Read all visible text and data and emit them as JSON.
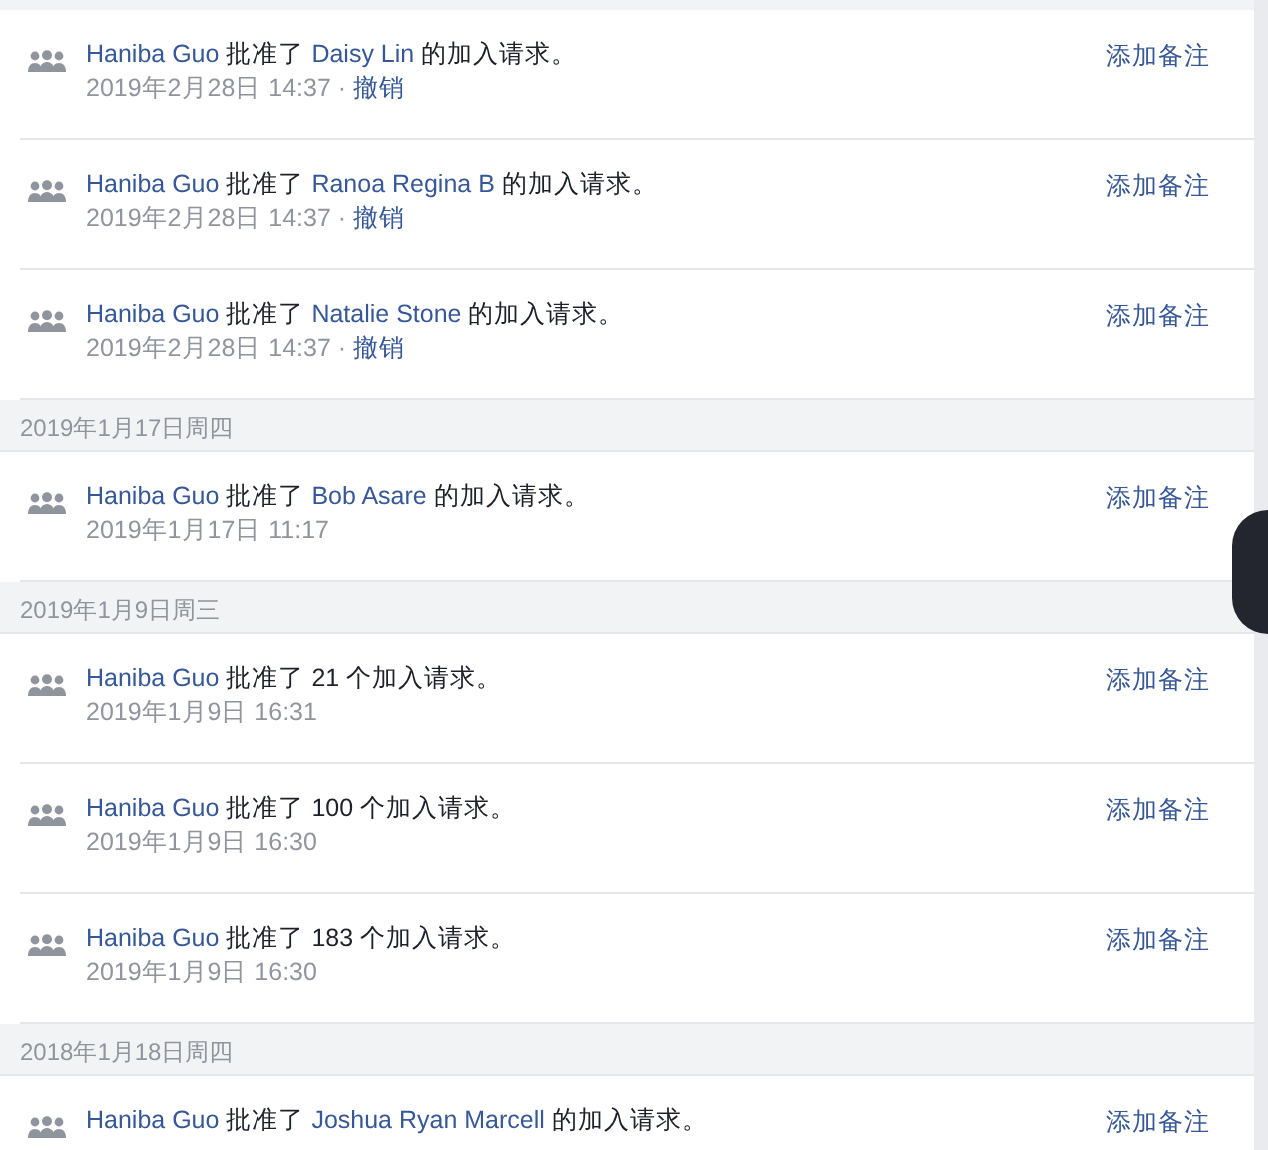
{
  "items": [
    {
      "kind": "entry",
      "actor": "Haniba Guo",
      "verb": "批准了",
      "target": "Daisy Lin",
      "tail": "的加入请求。",
      "time": "2019年2月28日 14:37",
      "separator": "·",
      "undo": "撤销",
      "action": "添加备注"
    },
    {
      "kind": "entry",
      "actor": "Haniba Guo",
      "verb": "批准了",
      "target": "Ranoa Regina B",
      "tail": "的加入请求。",
      "time": "2019年2月28日 14:37",
      "separator": "·",
      "undo": "撤销",
      "action": "添加备注"
    },
    {
      "kind": "entry",
      "actor": "Haniba Guo",
      "verb": "批准了",
      "target": "Natalie Stone",
      "tail": "的加入请求。",
      "time": "2019年2月28日 14:37",
      "separator": "·",
      "undo": "撤销",
      "action": "添加备注"
    },
    {
      "kind": "date",
      "text": "2019年1月17日周四"
    },
    {
      "kind": "entry",
      "actor": "Haniba Guo",
      "verb": "批准了",
      "target": "Bob Asare",
      "tail": "的加入请求。",
      "time": "2019年1月17日 11:17",
      "action": "添加备注"
    },
    {
      "kind": "date",
      "text": "2019年1月9日周三"
    },
    {
      "kind": "entry",
      "actor": "Haniba Guo",
      "verb": "批准了",
      "tail": "21 个加入请求。",
      "time": "2019年1月9日 16:31",
      "action": "添加备注"
    },
    {
      "kind": "entry",
      "actor": "Haniba Guo",
      "verb": "批准了",
      "tail": "100 个加入请求。",
      "time": "2019年1月9日 16:30",
      "action": "添加备注"
    },
    {
      "kind": "entry",
      "actor": "Haniba Guo",
      "verb": "批准了",
      "tail": "183 个加入请求。",
      "time": "2019年1月9日 16:30",
      "action": "添加备注"
    },
    {
      "kind": "date",
      "text": "2018年1月18日周四"
    },
    {
      "kind": "entry",
      "actor": "Haniba Guo",
      "verb": "批准了",
      "target": "Joshua Ryan Marcell",
      "tail": "的加入请求。",
      "action": "添加备注"
    }
  ]
}
